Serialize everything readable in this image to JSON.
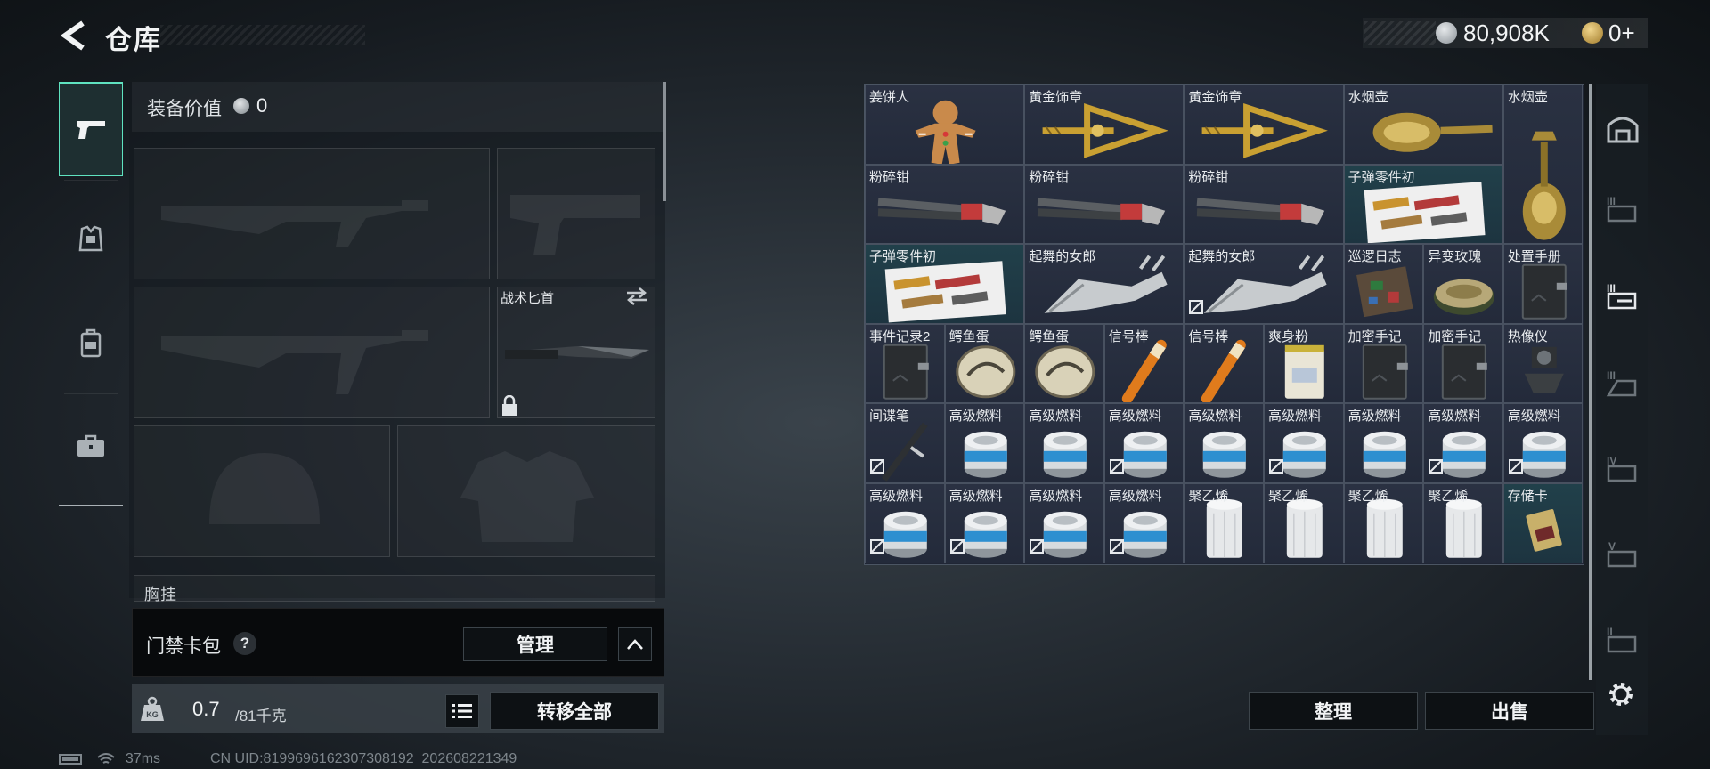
{
  "header": {
    "title": "仓库",
    "money": "80,908K",
    "premium": "0+"
  },
  "left_tabs": [
    "weapons",
    "armor",
    "backpack",
    "case"
  ],
  "equipment": {
    "value_label": "装备价值",
    "value": "0",
    "knife_name": "战术匕首",
    "chest_label": "胸挂"
  },
  "access_card": {
    "label": "门禁卡包",
    "help": "?",
    "manage_label": "管理"
  },
  "weight": {
    "current": "0.7",
    "max": "/81千克",
    "transfer_label": "转移全部"
  },
  "status": {
    "ping": "37ms",
    "uid": "CN UID:8199696162307308192_202608221349"
  },
  "inventory": {
    "items": [
      {
        "name": "姜饼人",
        "icon": "gingerbread-man",
        "teal": false,
        "unlockable": false
      },
      {
        "name": "黄金饰章",
        "icon": "gold-emblem",
        "teal": false,
        "unlockable": false
      },
      {
        "name": "黄金饰章",
        "icon": "gold-emblem",
        "teal": false,
        "unlockable": false
      },
      {
        "name": "水烟壶",
        "icon": "hookah-horizontal",
        "teal": false,
        "unlockable": false
      },
      {
        "name": "水烟壶",
        "icon": "hookah-vertical",
        "teal": false,
        "unlockable": false
      },
      {
        "name": "粉碎钳",
        "icon": "crusher-pliers",
        "teal": false,
        "unlockable": false
      },
      {
        "name": "粉碎钳",
        "icon": "crusher-pliers",
        "teal": false,
        "unlockable": false
      },
      {
        "name": "粉碎钳",
        "icon": "crusher-pliers",
        "teal": false,
        "unlockable": false
      },
      {
        "name": "子弹零件初",
        "icon": "bullet-parts",
        "teal": true,
        "unlockable": false
      },
      {
        "name": "子弹零件初",
        "icon": "bullet-parts",
        "teal": true,
        "unlockable": false
      },
      {
        "name": "起舞的女郎",
        "icon": "dancing-lady",
        "teal": false,
        "unlockable": false
      },
      {
        "name": "起舞的女郎",
        "icon": "dancing-lady",
        "teal": false,
        "unlockable": true
      },
      {
        "name": "巡逻日志",
        "icon": "circuit-board",
        "teal": false,
        "unlockable": false
      },
      {
        "name": "异变玫瑰",
        "icon": "rose-dish",
        "teal": false,
        "unlockable": false
      },
      {
        "name": "处置手册",
        "icon": "notebook",
        "teal": false,
        "unlockable": false
      },
      {
        "name": "事件记录2",
        "icon": "notebook",
        "teal": false,
        "unlockable": false
      },
      {
        "name": "鳄鱼蛋",
        "icon": "croc-egg",
        "teal": false,
        "unlockable": false
      },
      {
        "name": "鳄鱼蛋",
        "icon": "croc-egg",
        "teal": false,
        "unlockable": false
      },
      {
        "name": "信号棒",
        "icon": "signal-stick",
        "teal": false,
        "unlockable": false
      },
      {
        "name": "信号棒",
        "icon": "signal-stick",
        "teal": false,
        "unlockable": false
      },
      {
        "name": "爽身粉",
        "icon": "powder-can",
        "teal": false,
        "unlockable": false
      },
      {
        "name": "加密手记",
        "icon": "notebook",
        "teal": false,
        "unlockable": false
      },
      {
        "name": "加密手记",
        "icon": "notebook",
        "teal": false,
        "unlockable": false
      },
      {
        "name": "热像仪",
        "icon": "thermal-imager",
        "teal": false,
        "unlockable": false
      },
      {
        "name": "间谍笔",
        "icon": "spy-pen",
        "teal": false,
        "unlockable": true
      },
      {
        "name": "高级燃料",
        "icon": "fuel-can",
        "teal": false,
        "unlockable": false
      },
      {
        "name": "高级燃料",
        "icon": "fuel-can",
        "teal": false,
        "unlockable": false
      },
      {
        "name": "高级燃料",
        "icon": "fuel-can",
        "teal": false,
        "unlockable": true
      },
      {
        "name": "高级燃料",
        "icon": "fuel-can",
        "teal": false,
        "unlockable": false
      },
      {
        "name": "高级燃料",
        "icon": "fuel-can",
        "teal": false,
        "unlockable": true
      },
      {
        "name": "高级燃料",
        "icon": "fuel-can",
        "teal": false,
        "unlockable": false
      },
      {
        "name": "高级燃料",
        "icon": "fuel-can",
        "teal": false,
        "unlockable": true
      },
      {
        "name": "高级燃料",
        "icon": "fuel-can",
        "teal": false,
        "unlockable": true
      },
      {
        "name": "高级燃料",
        "icon": "fuel-can",
        "teal": false,
        "unlockable": true
      },
      {
        "name": "高级燃料",
        "icon": "fuel-can",
        "teal": false,
        "unlockable": true
      },
      {
        "name": "高级燃料",
        "icon": "fuel-can",
        "teal": false,
        "unlockable": true
      },
      {
        "name": "高级燃料",
        "icon": "fuel-can",
        "teal": false,
        "unlockable": true
      },
      {
        "name": "聚乙烯",
        "icon": "polyethylene-roll",
        "teal": false,
        "unlockable": false
      },
      {
        "name": "聚乙烯",
        "icon": "polyethylene-roll",
        "teal": false,
        "unlockable": false
      },
      {
        "name": "聚乙烯",
        "icon": "polyethylene-roll",
        "teal": false,
        "unlockable": false
      },
      {
        "name": "聚乙烯",
        "icon": "polyethylene-roll",
        "teal": false,
        "unlockable": false
      },
      {
        "name": "存储卡",
        "icon": "memory-card",
        "teal": true,
        "unlockable": false
      }
    ],
    "sort_label": "整理",
    "sell_label": "出售"
  },
  "right_tabs": [
    "all",
    "tier-3-a",
    "tier-3-b",
    "tier-3-c",
    "tier-4",
    "tier-5",
    "tier-2"
  ],
  "colors": {
    "accent": "#5fe3c0",
    "gold": "#c9a032",
    "panel": "#202635"
  }
}
